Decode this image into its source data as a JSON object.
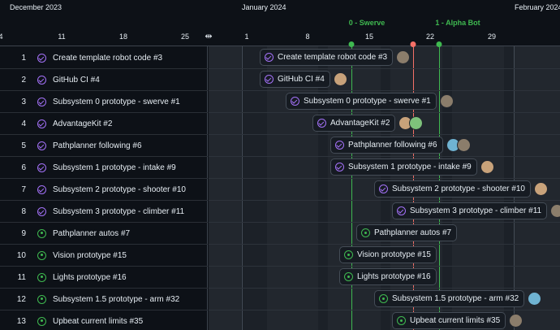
{
  "months": [
    "December 2023",
    "January 2024",
    "February 2024"
  ],
  "days": [
    "4",
    "11",
    "18",
    "25",
    "1",
    "8",
    "15",
    "22",
    "29"
  ],
  "milestones": [
    "0 - Swerve",
    "1 - Alpha Bot"
  ],
  "colors": {
    "done": "#a371f7",
    "open": "#3fb950",
    "milestone": "#3fb950",
    "today": "#f47067"
  },
  "rows": [
    {
      "num": "1",
      "title": "Create template robot code  #3",
      "bar": "Create template robot code #3",
      "state": "done",
      "avatars": [
        "person-avatar"
      ]
    },
    {
      "num": "2",
      "title": "GitHub CI  #4",
      "bar": "GitHub CI #4",
      "state": "done",
      "avatars": [
        "fox-avatar"
      ]
    },
    {
      "num": "3",
      "title": "Subsystem 0 prototype - swerve  #1",
      "bar": "Subsystem 0 prototype - swerve #1",
      "state": "done",
      "avatars": [
        "person-avatar"
      ]
    },
    {
      "num": "4",
      "title": "AdvantageKit  #2",
      "bar": "AdvantageKit #2",
      "state": "done",
      "avatars": [
        "fox-avatar",
        "green-avatar"
      ]
    },
    {
      "num": "5",
      "title": "Pathplanner following  #6",
      "bar": "Pathplanner following #6",
      "state": "done",
      "avatars": [
        "tree-avatar",
        "person-avatar"
      ]
    },
    {
      "num": "6",
      "title": "Subsystem 1 prototype - intake  #9",
      "bar": "Subsystem 1 prototype - intake #9",
      "state": "done",
      "avatars": [
        "fox-avatar"
      ]
    },
    {
      "num": "7",
      "title": "Subsystem 2 prototype - shooter  #10",
      "bar": "Subsystem 2 prototype - shooter #10",
      "state": "done",
      "avatars": [
        "fox-avatar"
      ]
    },
    {
      "num": "8",
      "title": "Subsystem 3 prototype - climber  #11",
      "bar": "Subsystem 3 prototype - climber #11",
      "state": "done",
      "avatars": [
        "person-avatar"
      ]
    },
    {
      "num": "9",
      "title": "Pathplanner autos  #7",
      "bar": "Pathplanner autos #7",
      "state": "open",
      "avatars": []
    },
    {
      "num": "10",
      "title": "Vision prototype  #15",
      "bar": "Vision prototype #15",
      "state": "open",
      "avatars": []
    },
    {
      "num": "11",
      "title": "Lights prototype  #16",
      "bar": "Lights prototype #16",
      "state": "open",
      "avatars": []
    },
    {
      "num": "12",
      "title": "Subsystem 1.5 prototype - arm  #32",
      "bar": "Subsystem 1.5 prototype - arm #32",
      "state": "open",
      "avatars": [
        "tree-avatar"
      ]
    },
    {
      "num": "13",
      "title": "Upbeat current limits  #35",
      "bar": "Upbeat current limits #35",
      "state": "open",
      "avatars": [
        "person-avatar"
      ]
    }
  ]
}
